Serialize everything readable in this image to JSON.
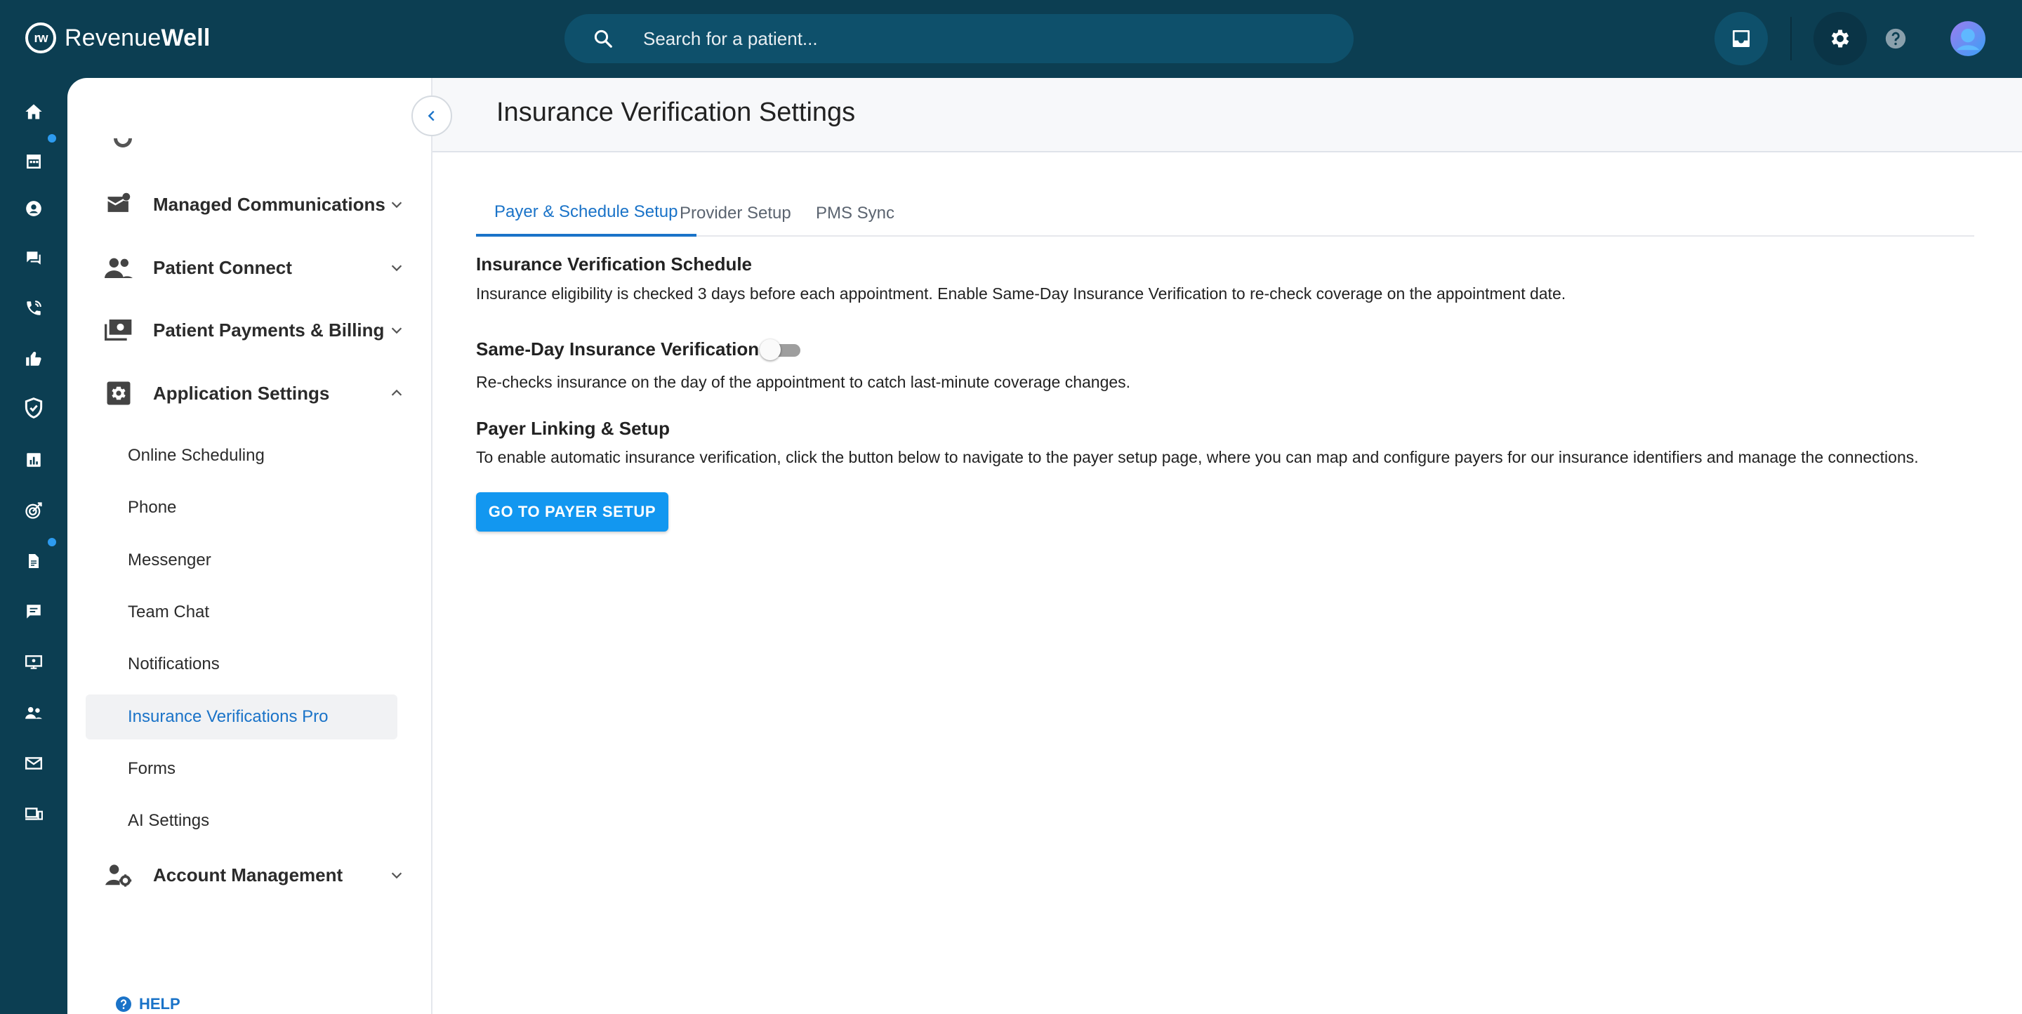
{
  "app": {
    "brand_light": "Revenue",
    "brand_bold": "Well",
    "logo_mark": "rw"
  },
  "search": {
    "placeholder": "Search for a patient..."
  },
  "colors": {
    "topbar": "#0c3e52",
    "accent": "#1a73c8",
    "button": "#1297f0",
    "notification_dot": "#2d9bf0"
  },
  "rail": {
    "icons": [
      "home-icon",
      "calendar-icon",
      "patient-icon",
      "chat-icon",
      "phone-icon",
      "thumbs-up-icon",
      "shield-icon",
      "reports-icon",
      "target-icon",
      "document-icon",
      "message-icon",
      "screen-icon",
      "people-icon",
      "mail-icon",
      "devices-icon"
    ]
  },
  "sidebar": {
    "groups": [
      {
        "label": "Managed Communications",
        "icon": "mail-alert-icon"
      },
      {
        "label": "Patient Connect",
        "icon": "people-icon"
      },
      {
        "label": "Patient Payments & Billing",
        "icon": "payments-icon"
      },
      {
        "label": "Application Settings",
        "icon": "settings-icon"
      },
      {
        "label": "Account Management",
        "icon": "account-settings-icon"
      }
    ],
    "settings_items": [
      "Online Scheduling",
      "Phone",
      "Messenger",
      "Team Chat",
      "Notifications",
      "Insurance Verifications Pro",
      "Forms",
      "AI Settings"
    ],
    "active_item": "Insurance Verifications Pro",
    "help_label": "HELP"
  },
  "main": {
    "title": "Insurance Verification Settings",
    "tabs": [
      "Payer & Schedule Setup",
      "Provider Setup",
      "PMS Sync"
    ],
    "active_tab": "Payer & Schedule Setup",
    "schedule": {
      "title": "Insurance Verification Schedule",
      "text": "Insurance eligibility is checked 3 days before each appointment. Enable Same-Day Insurance Verification to re-check coverage on the appointment date."
    },
    "same_day": {
      "title": "Same-Day Insurance Verification",
      "enabled": false,
      "text": "Re-checks insurance on the day of the appointment to catch last-minute coverage changes."
    },
    "payer": {
      "title": "Payer Linking & Setup",
      "text": "To enable automatic insurance verification, click the button below to navigate to the payer setup page, where you can map and configure payers for our insurance identifiers and manage the connections.",
      "button_label": "GO TO PAYER SETUP"
    }
  }
}
